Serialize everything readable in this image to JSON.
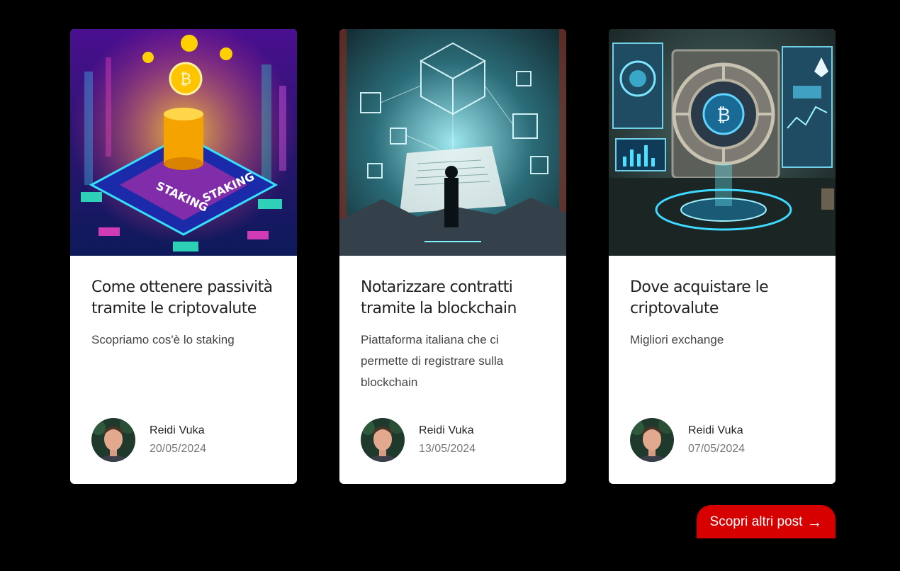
{
  "posts": [
    {
      "title": "Come ottenere passività tramite le criptovalute",
      "excerpt": "Scopriamo cos'è lo staking",
      "author": "Reidi Vuka",
      "date": "20/05/2024",
      "image_text": [
        "STAKING",
        "STAKING"
      ]
    },
    {
      "title": "Notarizzare contratti tramite la blockchain",
      "excerpt": "Piattaforma italiana che ci permette di registrare sulla blockchain",
      "author": "Reidi Vuka",
      "date": "13/05/2024"
    },
    {
      "title": "Dove acquistare le criptovalute",
      "excerpt": "Migliori exchange",
      "author": "Reidi Vuka",
      "date": "07/05/2024"
    }
  ],
  "more_button": {
    "label": "Scopri altri post",
    "icon": "arrow-right-icon",
    "color": "#d60000"
  }
}
